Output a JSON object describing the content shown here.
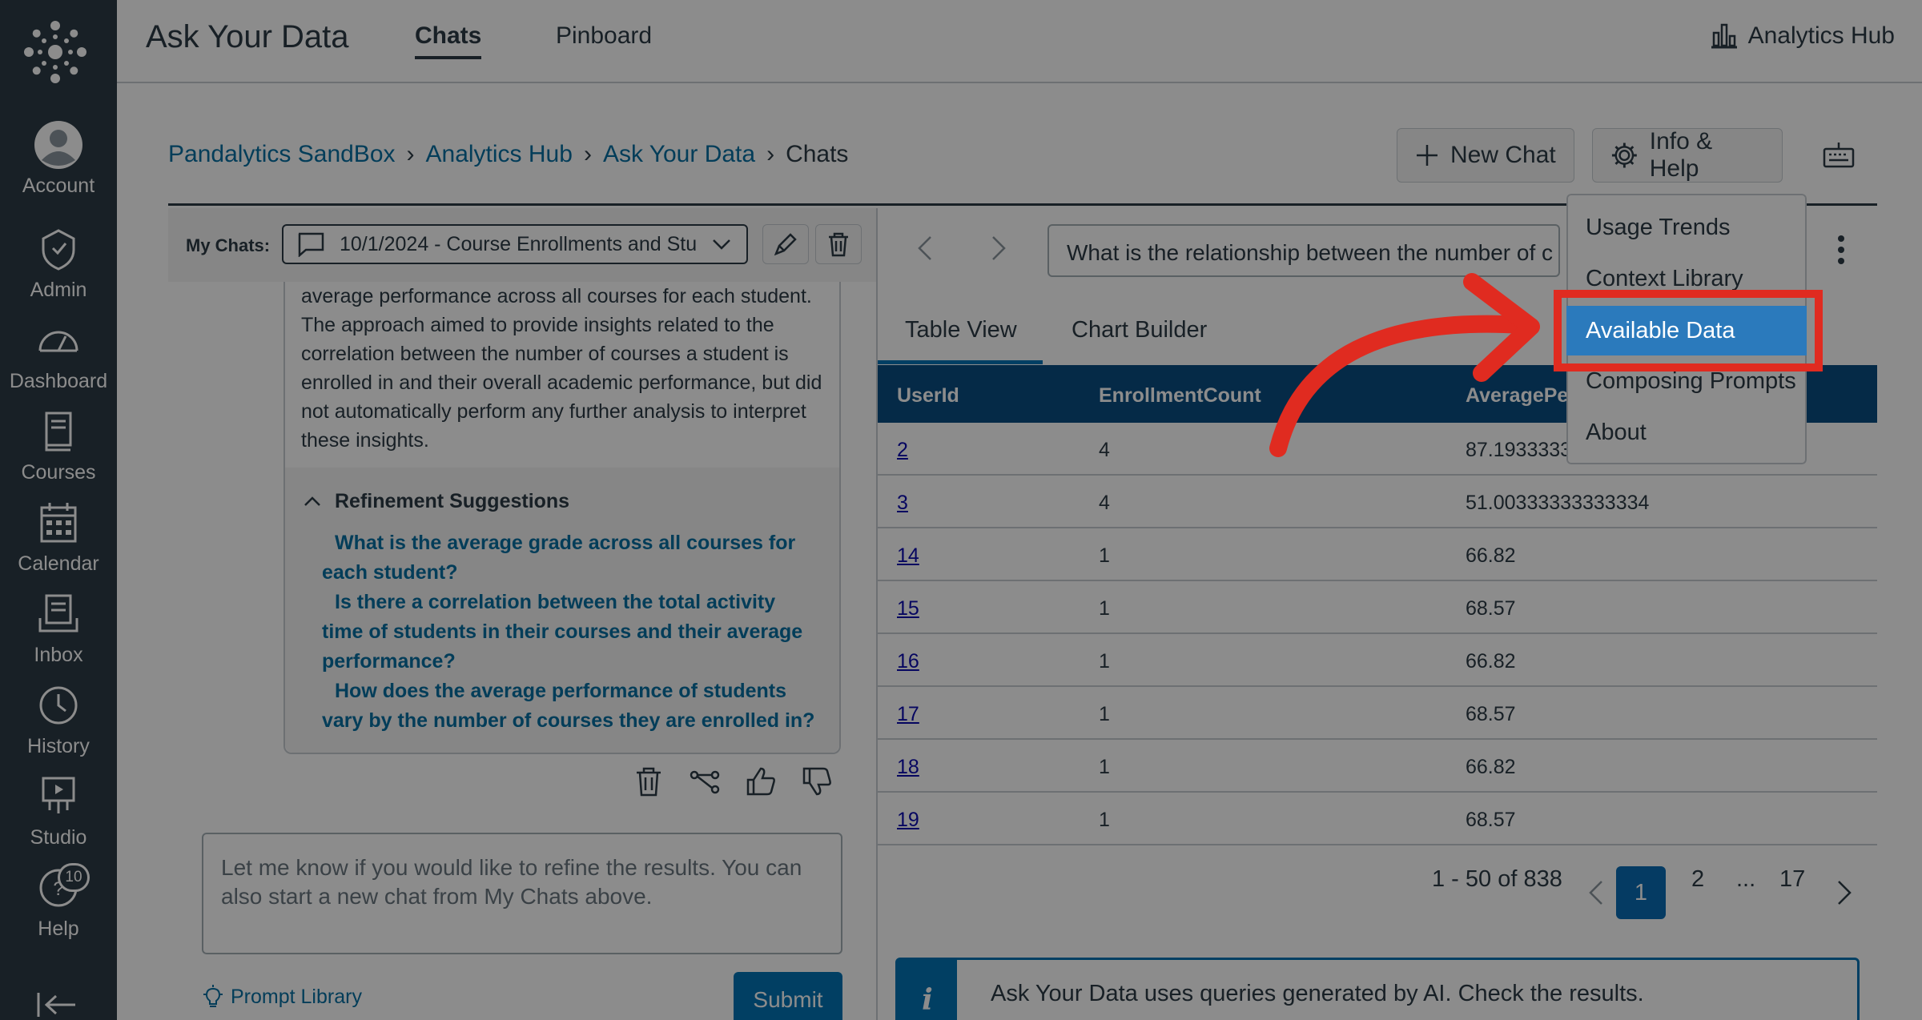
{
  "global_nav": {
    "items": [
      {
        "label": "Account"
      },
      {
        "label": "Admin"
      },
      {
        "label": "Dashboard"
      },
      {
        "label": "Courses"
      },
      {
        "label": "Calendar"
      },
      {
        "label": "Inbox"
      },
      {
        "label": "History"
      },
      {
        "label": "Studio"
      },
      {
        "label": "Help",
        "badge": "10"
      }
    ]
  },
  "header": {
    "title": "Ask Your Data",
    "tabs": [
      {
        "label": "Chats",
        "active": true
      },
      {
        "label": "Pinboard",
        "active": false
      }
    ],
    "hub_link": "Analytics Hub"
  },
  "breadcrumb": {
    "items": [
      "Pandalytics SandBox",
      "Analytics Hub",
      "Ask Your Data"
    ],
    "current": "Chats"
  },
  "toolbar": {
    "new_chat": "New Chat",
    "info_help": "Info & Help"
  },
  "chat_panel": {
    "label": "My Chats:",
    "selected_chat": "10/1/2024 - Course Enrollments and Stu",
    "answer_text": "average performance across all courses for each student. The approach aimed to provide insights related to the correlation between the number of courses a student is enrolled in and their overall academic performance, but did not automatically perform any further analysis to interpret these insights.",
    "refinement_title": "Refinement Suggestions",
    "suggestions": [
      "What is the average grade across all courses for each student?",
      "Is there a correlation between the total activity time of students in their courses and their average performance?",
      "How does the average performance of students vary by the number of courses they are enrolled in?"
    ],
    "prompt_placeholder": "Let me know if you would like to refine the results.  You can also start a new chat from My Chats above.",
    "prompt_library": "Prompt Library",
    "submit": "Submit"
  },
  "results": {
    "question": "What is the relationship between the number of c",
    "tabs": [
      "Table View",
      "Chart Builder"
    ],
    "columns": [
      "UserId",
      "EnrollmentCount",
      "AveragePer"
    ],
    "rows": [
      [
        "2",
        "4",
        "87.19333333"
      ],
      [
        "3",
        "4",
        "51.00333333333334"
      ],
      [
        "14",
        "1",
        "66.82"
      ],
      [
        "15",
        "1",
        "68.57"
      ],
      [
        "16",
        "1",
        "66.82"
      ],
      [
        "17",
        "1",
        "68.57"
      ],
      [
        "18",
        "1",
        "66.82"
      ],
      [
        "19",
        "1",
        "68.57"
      ]
    ],
    "pagination": {
      "range": "1 - 50 of 838",
      "current": "1",
      "next": "2",
      "ellipsis": "...",
      "last": "17"
    },
    "notice": "Ask Your Data uses queries generated by AI. Check the results."
  },
  "info_menu": {
    "items": [
      "Usage Trends",
      "Context Library",
      "Available Data",
      "Composing Prompts",
      "About"
    ],
    "highlighted": "Available Data"
  },
  "colors": {
    "nav_bg": "#2d3b45",
    "link": "#0770a3",
    "table_header": "#0a4d82",
    "primary": "#0374b5",
    "highlight_outline": "#e02b20"
  }
}
